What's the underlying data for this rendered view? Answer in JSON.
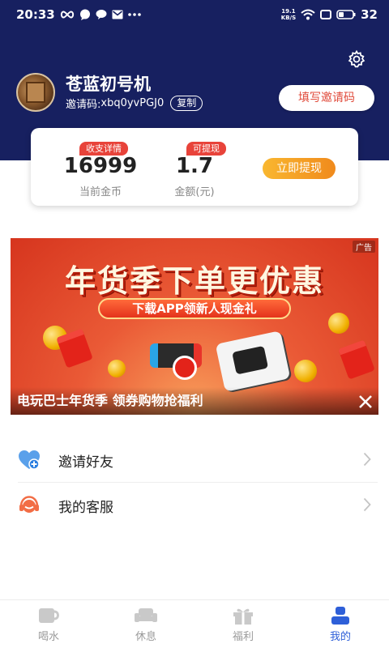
{
  "status_bar": {
    "time": "20:33",
    "net_speed_value": "19.1",
    "net_speed_unit": "KB/S",
    "battery": "32",
    "icons": [
      "infinity-icon",
      "chat-bubble-icon",
      "message-icon",
      "mail-icon",
      "more-dots-icon",
      "wifi-icon",
      "screen-icon",
      "battery-icon"
    ]
  },
  "profile": {
    "username": "苍蓝初号机",
    "invite_code_label": "邀请码:",
    "invite_code": "xbq0yvPGJ0",
    "copy_label": "复制",
    "fill_invite_label": "填写邀请码"
  },
  "wallet": {
    "coins_tag": "收支详情",
    "coins_value": "16999",
    "coins_label": "当前金币",
    "cash_tag": "可提现",
    "cash_value": "1.7",
    "cash_label": "金额(元)",
    "withdraw_label": "立即提现"
  },
  "ad": {
    "badge": "广告",
    "headline": "年货季下单更优惠",
    "subheadline": "下载APP领新人现金礼",
    "caption": "电玩巴士年货季 领券购物抢福利"
  },
  "menu": {
    "invite_friends": "邀请好友",
    "customer_service": "我的客服"
  },
  "tabs": [
    {
      "label": "喝水",
      "icon": "cup-icon",
      "active": false
    },
    {
      "label": "休息",
      "icon": "sofa-icon",
      "active": false
    },
    {
      "label": "福利",
      "icon": "gift-icon",
      "active": false
    },
    {
      "label": "我的",
      "icon": "person-icon",
      "active": true
    }
  ],
  "colors": {
    "header": "#172060",
    "accent_red": "#e8433a",
    "accent_orange": "#f0a024",
    "tab_active": "#2e5fd8",
    "tab_inactive": "#9a9a9a"
  }
}
